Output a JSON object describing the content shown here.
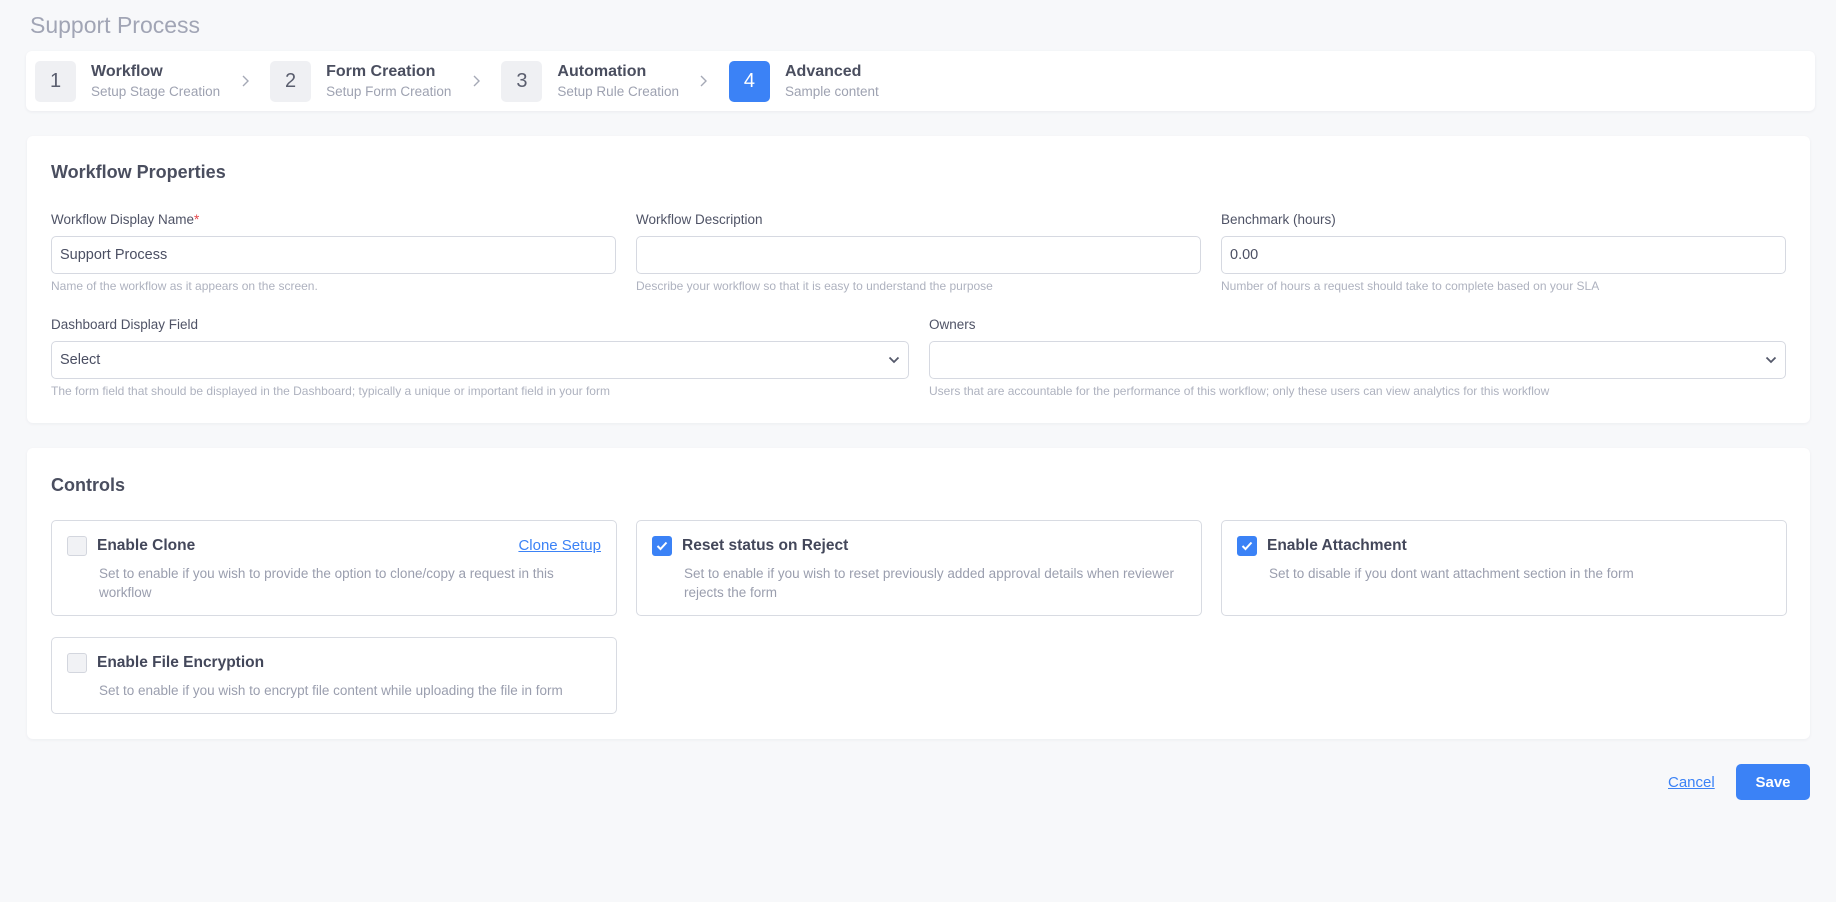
{
  "page": {
    "title": "Support Process"
  },
  "stepper": {
    "steps": [
      {
        "number": "1",
        "title": "Workflow",
        "subtitle": "Setup Stage Creation"
      },
      {
        "number": "2",
        "title": "Form Creation",
        "subtitle": "Setup Form Creation"
      },
      {
        "number": "3",
        "title": "Automation",
        "subtitle": "Setup Rule Creation"
      },
      {
        "number": "4",
        "title": "Advanced",
        "subtitle": "Sample content"
      }
    ],
    "active_step": 4
  },
  "properties": {
    "title": "Workflow Properties",
    "display_name": {
      "label": "Workflow Display Name",
      "required_mark": "*",
      "value": "Support Process",
      "help": "Name of the workflow as it appears on the screen."
    },
    "description": {
      "label": "Workflow Description",
      "value": "",
      "help": "Describe your workflow so that it is easy to understand the purpose"
    },
    "benchmark": {
      "label": "Benchmark (hours)",
      "value": "0.00",
      "help": "Number of hours a request should take to complete based on your SLA"
    },
    "dashboard_field": {
      "label": "Dashboard Display Field",
      "value": "Select",
      "help": "The form field that should be displayed in the Dashboard; typically a unique or important field in your form"
    },
    "owners": {
      "label": "Owners",
      "value": "",
      "help": "Users that are accountable for the performance of this workflow; only these users can view analytics for this workflow"
    }
  },
  "controls": {
    "title": "Controls",
    "items": [
      {
        "title": "Enable Clone",
        "checked": false,
        "link": "Clone Setup",
        "desc_line1": "Set to enable if you wish to provide the option to clone/copy a request in this",
        "desc_line2": "workflow"
      },
      {
        "title": "Reset status on Reject",
        "checked": true,
        "desc_line1": "Set to enable if you wish to reset previously added approval details when reviewer",
        "desc_line2": "rejects the form"
      },
      {
        "title": "Enable Attachment",
        "checked": true,
        "desc_line1": "Set to disable if you dont want attachment section in the form",
        "desc_line2": ""
      },
      {
        "title": "Enable File Encryption",
        "checked": false,
        "desc_line1": "Set to enable if you wish to encrypt file content while uploading the file in form",
        "desc_line2": ""
      }
    ]
  },
  "footer": {
    "cancel_label": "Cancel",
    "save_label": "Save"
  },
  "colors": {
    "accent": "#3b82f6",
    "required": "#e5484d",
    "background": "#f7f8fa"
  }
}
